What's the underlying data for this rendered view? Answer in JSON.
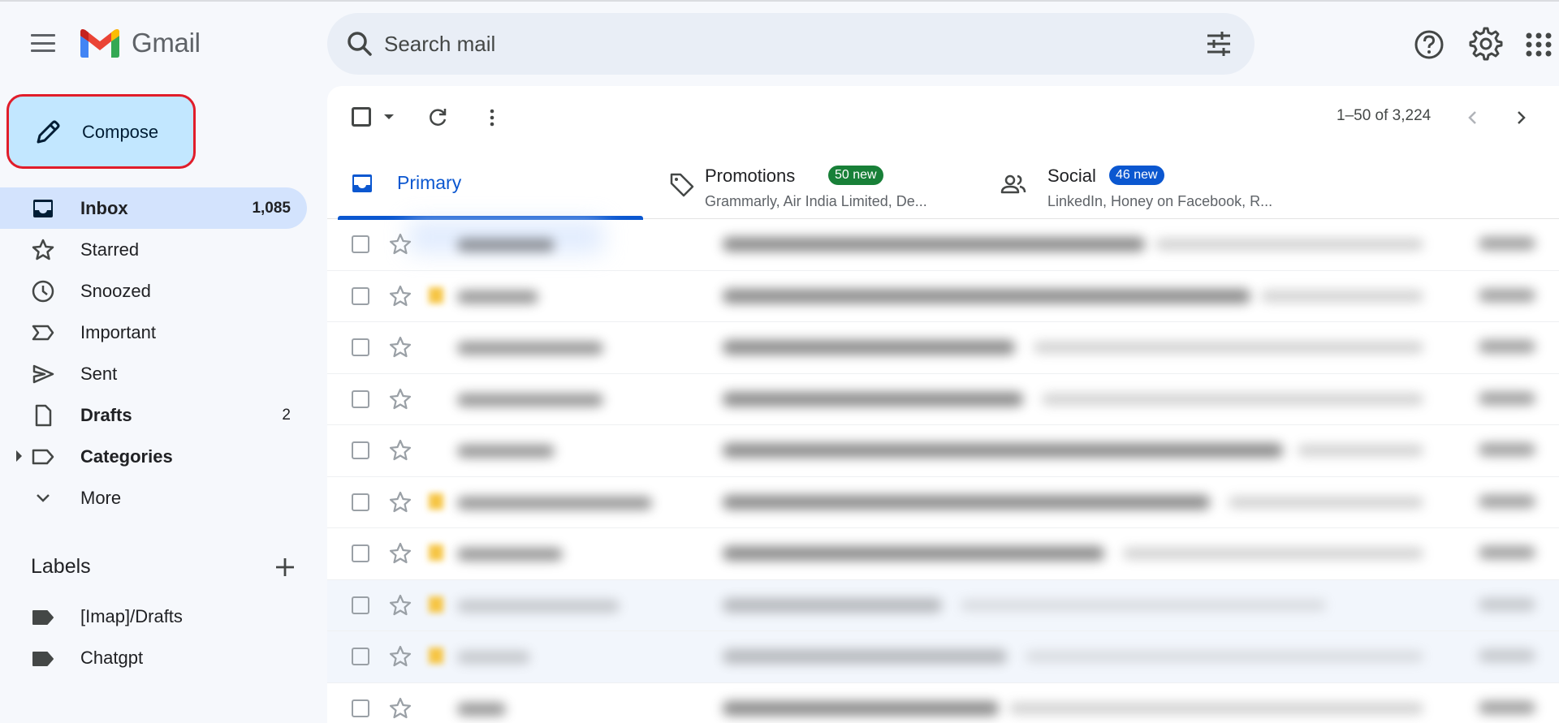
{
  "app": {
    "name": "Gmail"
  },
  "search": {
    "placeholder": "Search mail"
  },
  "sidebar": {
    "compose_label": "Compose",
    "items": [
      {
        "label": "Inbox",
        "count": "1,085",
        "icon": "inbox-icon"
      },
      {
        "label": "Starred",
        "count": "",
        "icon": "star-icon"
      },
      {
        "label": "Snoozed",
        "count": "",
        "icon": "clock-icon"
      },
      {
        "label": "Important",
        "count": "",
        "icon": "important-icon"
      },
      {
        "label": "Sent",
        "count": "",
        "icon": "send-icon"
      },
      {
        "label": "Drafts",
        "count": "2",
        "icon": "draft-icon"
      },
      {
        "label": "Categories",
        "count": "",
        "icon": "label-outline-icon"
      },
      {
        "label": "More",
        "count": "",
        "icon": "chevron-down-icon"
      }
    ],
    "labels_title": "Labels",
    "labels": [
      {
        "label": "[Imap]/Drafts",
        "icon": "label-icon"
      },
      {
        "label": "Chatgpt",
        "icon": "label-icon"
      }
    ]
  },
  "toolbar": {
    "pager": "1–50 of 3,224"
  },
  "tabs": {
    "primary": {
      "label": "Primary"
    },
    "promotions": {
      "label": "Promotions",
      "badge": "50 new",
      "badge_color": "#188038",
      "preview": "Grammarly, Air India Limited, De..."
    },
    "social": {
      "label": "Social",
      "badge": "46 new",
      "badge_color": "#0b57d0",
      "preview": "LinkedIn, Honey on Facebook, R..."
    }
  },
  "colors": {
    "accent": "#0b57d0",
    "compose_bg": "#c2e7ff",
    "compose_highlight": "#e11d2a",
    "active_nav": "#d3e3fd"
  }
}
